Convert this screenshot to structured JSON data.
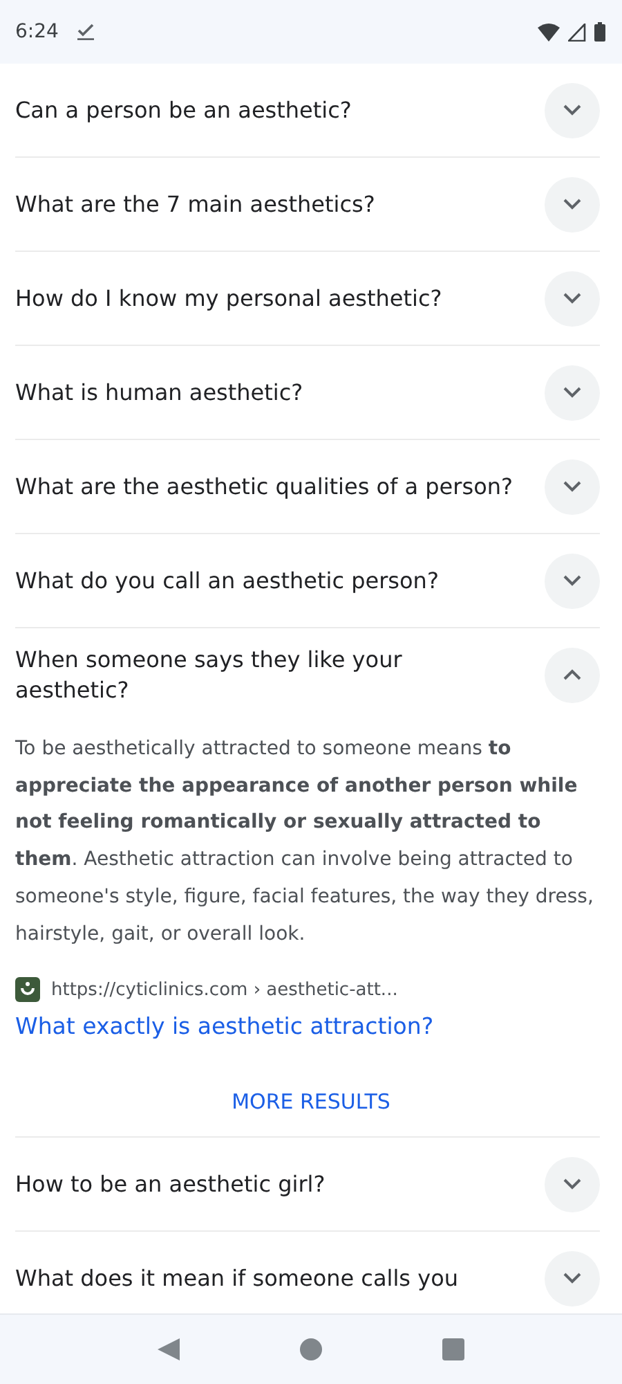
{
  "status_bar": {
    "time": "6:24"
  },
  "questions": [
    {
      "question": "Can a person be an aesthetic?",
      "expanded": false
    },
    {
      "question": "What are the 7 main aesthetics?",
      "expanded": false
    },
    {
      "question": "How do I know my personal aesthetic?",
      "expanded": false
    },
    {
      "question": "What is human aesthetic?",
      "expanded": false
    },
    {
      "question": "What are the aesthetic qualities of a person?",
      "expanded": false
    },
    {
      "question": "What do you call an aesthetic person?",
      "expanded": false
    },
    {
      "question": "When someone says they like your aesthetic?",
      "expanded": true,
      "answer": "To be aesthetically attracted to someone means **to appreciate the appearance of another person while not feeling romantically or sexually attracted to them**. Aesthetic attraction can involve being attracted to someone's style, figure, facial features, the way they dress, hairstyle, gait, or overall look.",
      "source_url": "https://cyticlinics.com › aesthetic-att...",
      "source_title": "What exactly is aesthetic attraction?"
    }
  ],
  "more_results": "MORE RESULTS",
  "more_questions": [
    {
      "question": "How to be an aesthetic girl?",
      "expanded": false
    },
    {
      "question": "What does it mean if someone calls you",
      "expanded": false
    }
  ]
}
